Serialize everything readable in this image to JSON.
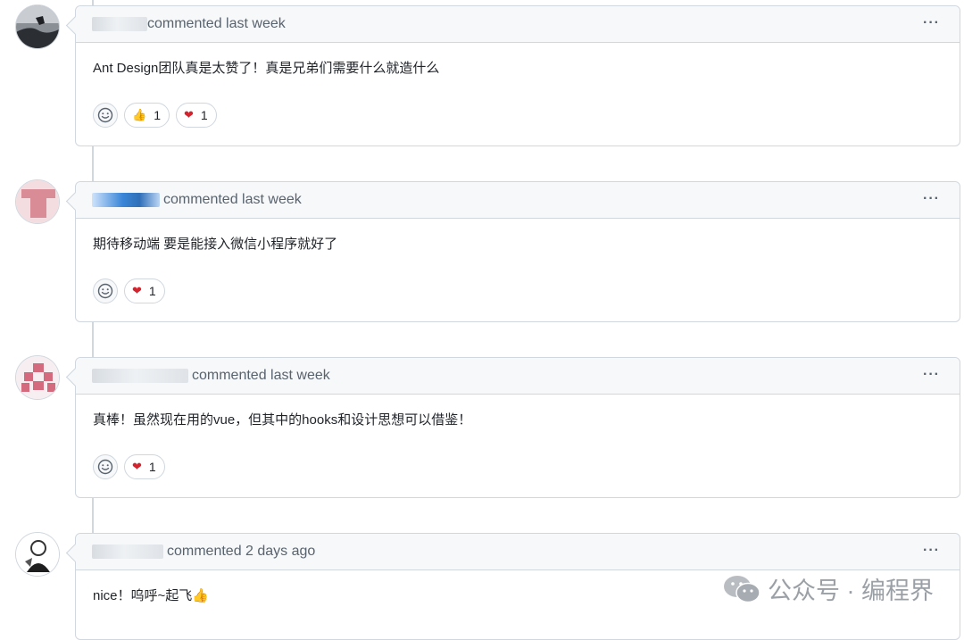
{
  "comments": [
    {
      "meta": "commented last week",
      "body": "Ant Design团队真是太赞了！真是兄弟们需要什么就造什么",
      "reactions": [
        {
          "emoji": "👍",
          "count": "1"
        },
        {
          "emoji": "❤",
          "count": "1"
        }
      ]
    },
    {
      "meta": "commented last week",
      "body": "期待移动端 要是能接入微信小程序就好了",
      "reactions": [
        {
          "emoji": "❤",
          "count": "1"
        }
      ]
    },
    {
      "meta": "commented last week",
      "body": "真棒！虽然现在用的vue，但其中的hooks和设计思想可以借鉴！",
      "reactions": [
        {
          "emoji": "❤",
          "count": "1"
        }
      ]
    },
    {
      "meta": "commented 2 days ago",
      "body": "nice！呜呼~起飞👍",
      "reactions": []
    }
  ],
  "menu_glyph": "···",
  "watermark": {
    "text": "公众号 · 编程界"
  }
}
